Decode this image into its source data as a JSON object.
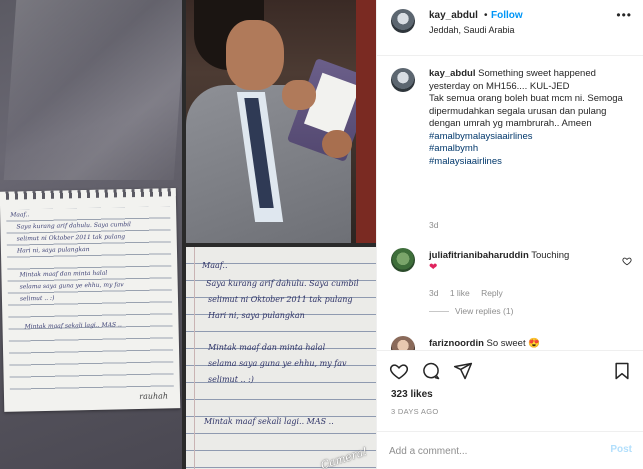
{
  "post": {
    "username": "kay_abdul",
    "separator": "•",
    "follow_label": "Follow",
    "location": "Jeddah, Saudi Arabia",
    "more_label": "•••"
  },
  "caption": {
    "username": "kay_abdul",
    "text_line1": "Something sweet happened yesterday on MH156.... KUL-JED",
    "text_line2": "Tak semua orang boleh buat mcm ni. Semoga dipermudahkan segala urusan dan pulang dengan umrah yg mambrurah.. Ameen",
    "hashtags": [
      "#amalbymalaysiaairlines",
      "#amalbymh",
      "#malaysiaairlines"
    ],
    "age": "3d"
  },
  "comments": [
    {
      "username": "juliafitrianibaharuddin",
      "text": "Touching",
      "emoji": "❤",
      "age": "3d",
      "likes": "1 like",
      "reply_label": "Reply",
      "view_replies": "View replies (1)"
    },
    {
      "username": "fariznoordin",
      "text": "So sweet",
      "emoji": "😍"
    }
  ],
  "stats": {
    "likes": "323 likes",
    "posted": "3 DAYS AGO"
  },
  "add_comment": {
    "placeholder": "Add a comment...",
    "post_label": "Post"
  },
  "icons": {
    "like": "heart-icon",
    "comment": "comment-icon",
    "share": "share-icon",
    "save": "bookmark-icon",
    "comment_like": "small-heart-icon"
  },
  "colors": {
    "accent": "#0095f6",
    "hashtag": "#00376b",
    "muted": "#8e8e8e",
    "post_disabled": "#b2dffc"
  },
  "photo_notes": {
    "small_note_lines": [
      "Maaf..",
      "Saya kurang arif dahulu. Saya cumbil",
      "selimut ni Oktober 2011 tak pulang",
      "Hari ni, saya pulangkan",
      "Mintak maaf dan minta halal",
      "selama saya guna ye ehhu, my fav",
      "selimut .. :)",
      "Mintak maaf sekali lagi.. MAS .."
    ],
    "brand": "rauhah",
    "large_note_lines": [
      "Maaf..",
      "Saya kurang arif dahulu. Saya cumbil",
      "selimut ni Oktober 2011 tak pulang",
      "Hari ni, saya pulangkan",
      "Mintak maaf dan minta halal",
      "selama saya guna ye ehhu, my fav",
      "selimut .. :)",
      "Mintak maaf sekali lagi.. MAS .."
    ],
    "stamp": "Camera!"
  }
}
